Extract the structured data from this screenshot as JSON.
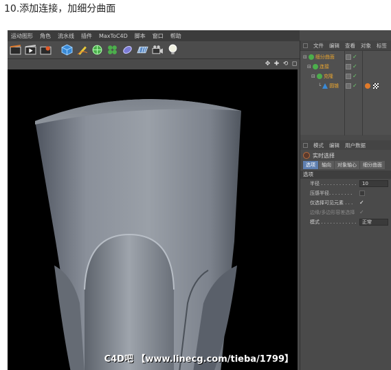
{
  "caption": "10.添加连接，加细分曲面",
  "menu": [
    "运动图形",
    "角色",
    "流水线",
    "插件",
    "MaxToC4D",
    "脚本",
    "窗口",
    "帮助"
  ],
  "toolbar_icons": [
    "film-clapper-icon",
    "film-render-icon",
    "film-settings-icon",
    "cube-icon",
    "pen-icon",
    "subdivision-icon",
    "cloner-icon",
    "deformer-icon",
    "floor-icon",
    "camera-icon",
    "light-icon"
  ],
  "viewport": {
    "nav_icons": [
      "move-icon",
      "zoom-icon",
      "rotate-icon",
      "maximize-icon"
    ],
    "watermark": "C4D吧 【www.linecg.com/tieba/1799】"
  },
  "objects_panel": {
    "menu": [
      "文件",
      "编辑",
      "查看",
      "对象",
      "标签"
    ],
    "rows": [
      {
        "name": "细分曲面",
        "indent": 0,
        "check": "✓"
      },
      {
        "name": "连接",
        "indent": 1,
        "check": "✓"
      },
      {
        "name": "克隆",
        "indent": 2,
        "check": "✓"
      },
      {
        "name": "圆锥",
        "indent": 3,
        "check": "✓"
      }
    ]
  },
  "attributes_panel": {
    "menu": [
      "模式",
      "编辑",
      "用户数据"
    ],
    "tool_name": "实时选择",
    "tabs": [
      "选项",
      "轴向",
      "对象轴心",
      "细分曲面"
    ],
    "active_tab": "选项",
    "section": "选项",
    "params": [
      {
        "label": "半径 . . . . . . . . . . . .",
        "value": "10",
        "type": "field"
      },
      {
        "label": "压感半径. . . . . . . .",
        "value": "",
        "type": "checkbox"
      },
      {
        "label": "仅选择可见元素 . . .",
        "value": "✓",
        "type": "checkbox"
      },
      {
        "label": "边缘/多边形容差选择",
        "value": "✓",
        "type": "checkbox-dim"
      },
      {
        "label": "模式 . . . . . . . . . . . .",
        "value": "正常",
        "type": "field"
      }
    ]
  }
}
